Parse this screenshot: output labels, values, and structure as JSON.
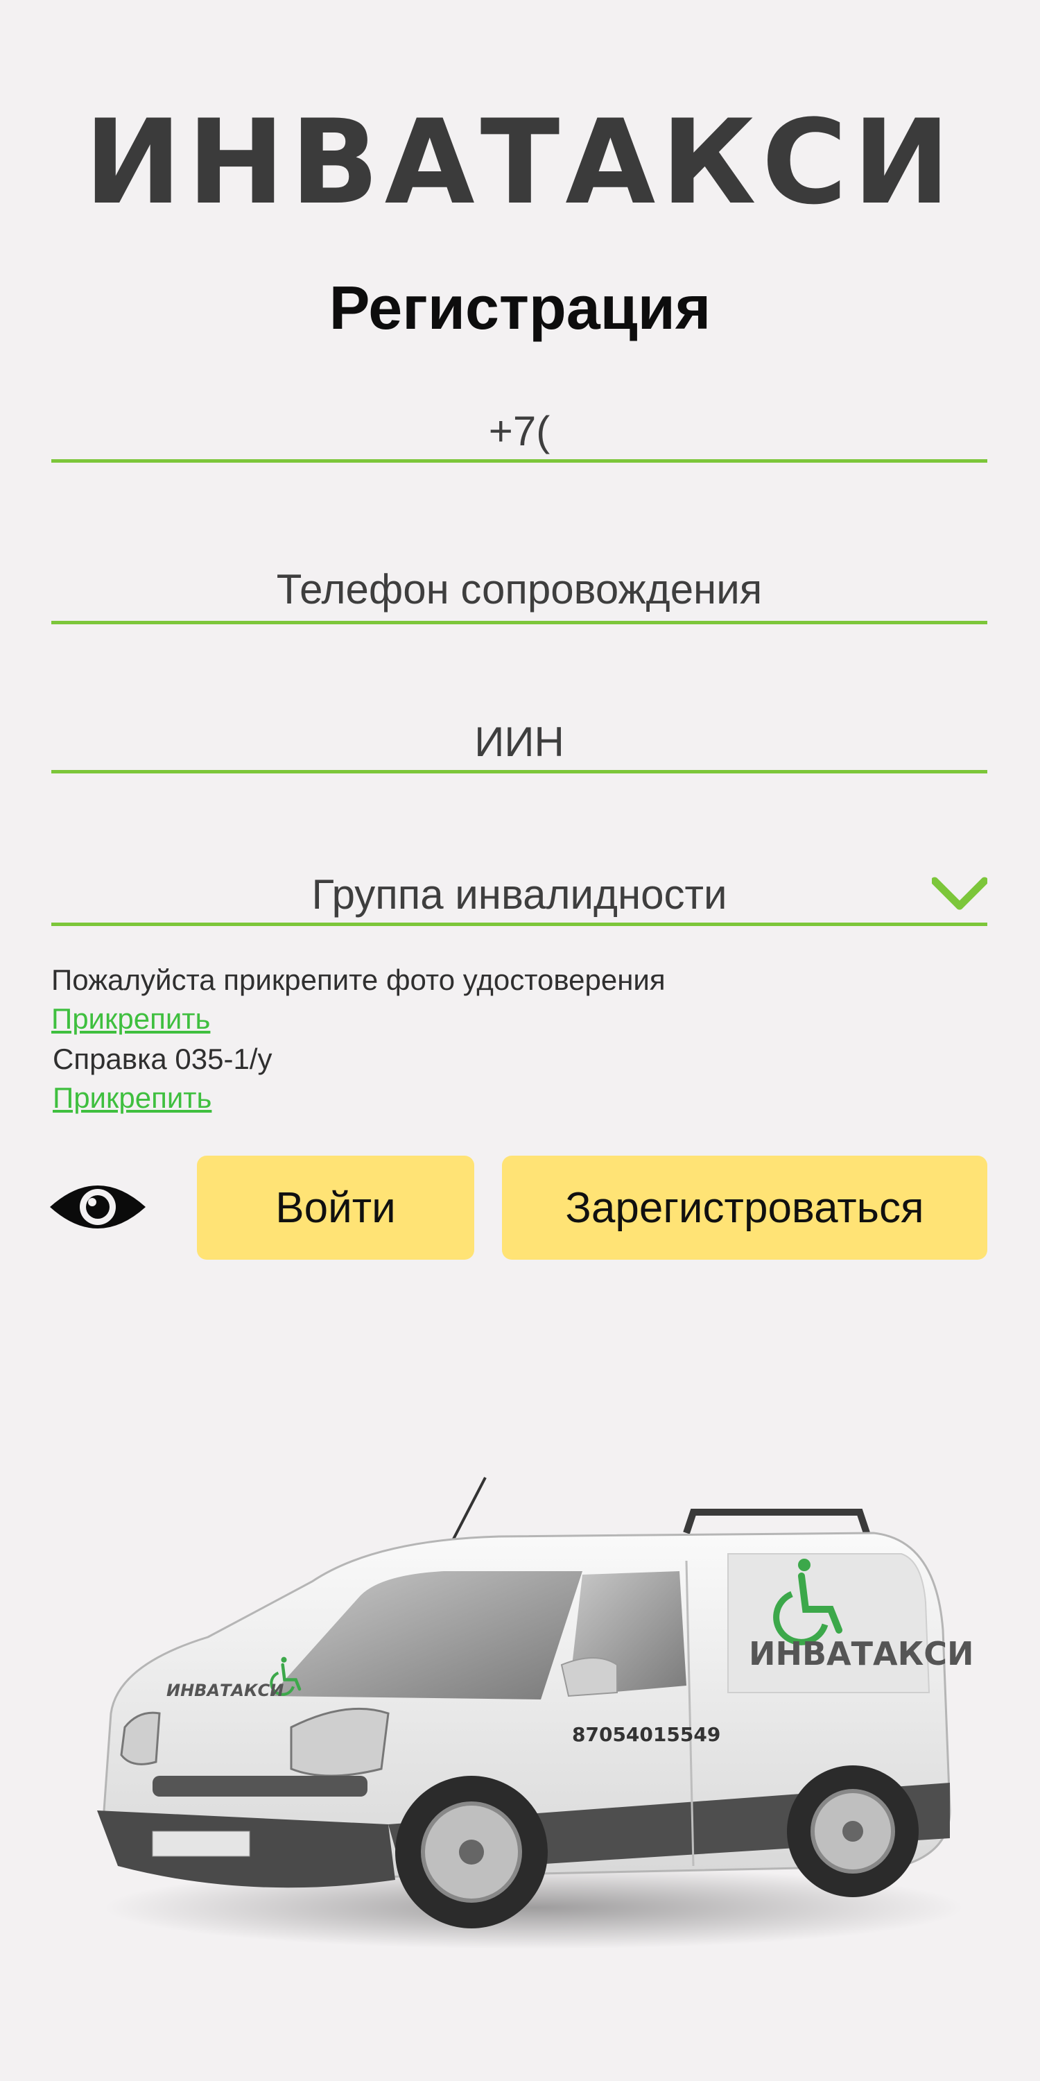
{
  "logo": {
    "text": "ИНВАТАКСИ"
  },
  "title": "Регистрация",
  "fields": {
    "phone": {
      "value": "+7("
    },
    "escort_phone": {
      "placeholder": "Телефон сопровождения"
    },
    "iin": {
      "placeholder": "ИИН"
    },
    "disability_group": {
      "placeholder": "Группа инвалидности"
    }
  },
  "attach": {
    "id_note": "Пожалуйста прикрепите фото удостоверения",
    "id_link": "Прикрепить",
    "cert_note": "Справка 035-1/у",
    "cert_link": "Прикрепить"
  },
  "buttons": {
    "login": "Войти",
    "register": "Зарегистроваться"
  },
  "van": {
    "side_logo": "ИНВАТАКСИ",
    "hood_logo": "ИНВАТАКСИ",
    "phone": "87054015549"
  },
  "colors": {
    "accent": "#7cc63a",
    "button": "#ffe375",
    "link": "#3fbf3f"
  }
}
